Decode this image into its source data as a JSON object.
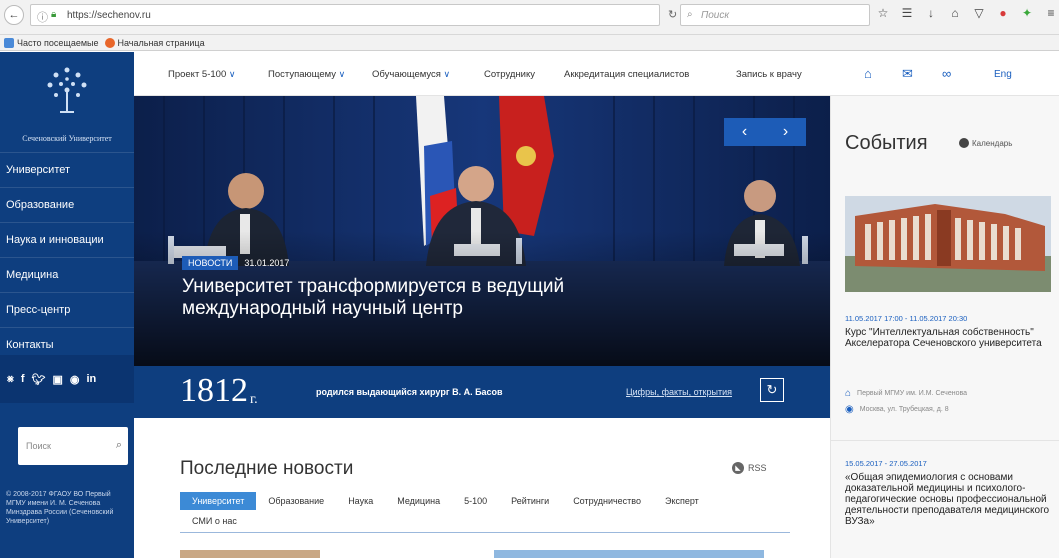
{
  "browser": {
    "url": "https://sechenov.ru",
    "search_placeholder": "Поиск",
    "bookmarks": [
      {
        "label": "Часто посещаемые",
        "color": "#4a8ad8"
      },
      {
        "label": "Начальная страница",
        "color": "#e8662a"
      }
    ]
  },
  "sidebar": {
    "logo_text": "Сеченовский Университет",
    "menu": [
      "Университет",
      "Образование",
      "Наука и инновации",
      "Медицина",
      "Пресс-центр",
      "Контакты"
    ],
    "search_placeholder": "Поиск",
    "copyright": "© 2008-2017 ФГАОУ ВО Первый МГМУ имени И. М. Сеченова Минздрава России (Сеченовский Университет)"
  },
  "topnav": {
    "items": [
      "Проект 5-100",
      "Поступающему",
      "Обучающемуся",
      "Сотруднику",
      "Аккредитация специалистов",
      "Запись к врачу"
    ],
    "lang": "Eng"
  },
  "hero": {
    "badge": "НОВОСТИ",
    "date": "31.01.2017",
    "title": "Университет трансформируется в ведущий международный научный центр"
  },
  "fact": {
    "year": "1812",
    "suffix": "г.",
    "text": "родился выдающийся хирург В. А. Басов",
    "link": "Цифры, факты, открытия"
  },
  "news": {
    "title": "Последние новости",
    "rss": "RSS",
    "tabs": [
      "Университет",
      "Образование",
      "Наука",
      "Медицина",
      "5-100",
      "Рейтинги",
      "Сотрудничество",
      "Эксперт"
    ],
    "tab_row2": "СМИ о нас"
  },
  "events": {
    "title": "События",
    "calendar": "Календарь",
    "event1": {
      "date": "11.05.2017 17:00 - 11.05.2017 20:30",
      "title": "Курс \"Интеллектуальная собственность\" Акселератора Сеченовского университета",
      "org": "Первый МГМУ им. И.М. Сеченова",
      "addr": "Москва, ул. Трубецкая, д. 8"
    },
    "event2": {
      "date": "15.05.2017 - 27.05.2017",
      "title": "«Общая эпидемиология с основами доказательной медицины и психолого-педагогические основы профессиональной деятельности преподавателя медицинского ВУЗа»"
    }
  },
  "colors": {
    "brand": "#0e3e7f",
    "accent": "#1d5cb7",
    "tab_active": "#3c8ad6"
  }
}
